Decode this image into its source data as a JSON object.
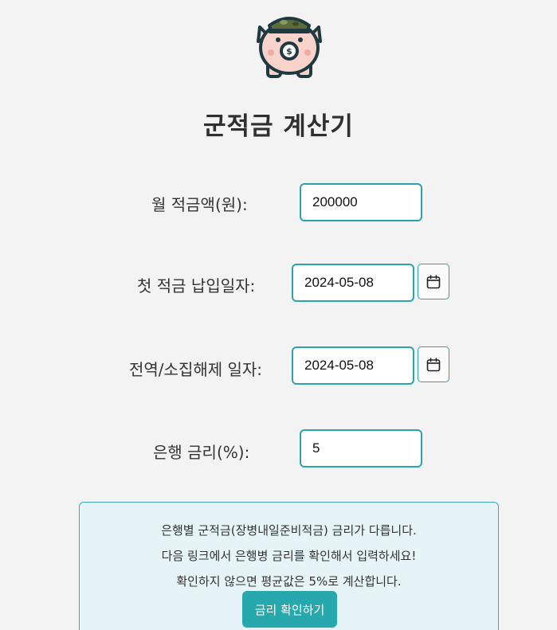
{
  "header": {
    "title": "군적금 계산기",
    "logo_icon": "piggy-bank-soldier-icon"
  },
  "form": {
    "monthly_amount": {
      "label": "월 적금액(원):",
      "value": "200000"
    },
    "first_deposit_date": {
      "label": "첫 적금 납입일자:",
      "value": "2024-05-08",
      "icon": "calendar-icon"
    },
    "discharge_date": {
      "label": "전역/소집해제 일자:",
      "value": "2024-05-08",
      "icon": "calendar-icon"
    },
    "bank_rate": {
      "label": "은행 금리(%):",
      "value": "5"
    }
  },
  "info": {
    "line1": "은행별 군적금(장병내일준비적금) 금리가 다릅니다.",
    "line2": "다음 링크에서 은행병 금리를 확인해서 입력하세요!",
    "line3": "확인하지 않으면 평균값은 5%로 계산합니다.",
    "button_label": "금리 확인하기"
  },
  "colors": {
    "accent": "#2aa3ad",
    "button": "#27a8ad",
    "info_background": "#e6f4f8",
    "page_background": "#f3f3f3"
  }
}
